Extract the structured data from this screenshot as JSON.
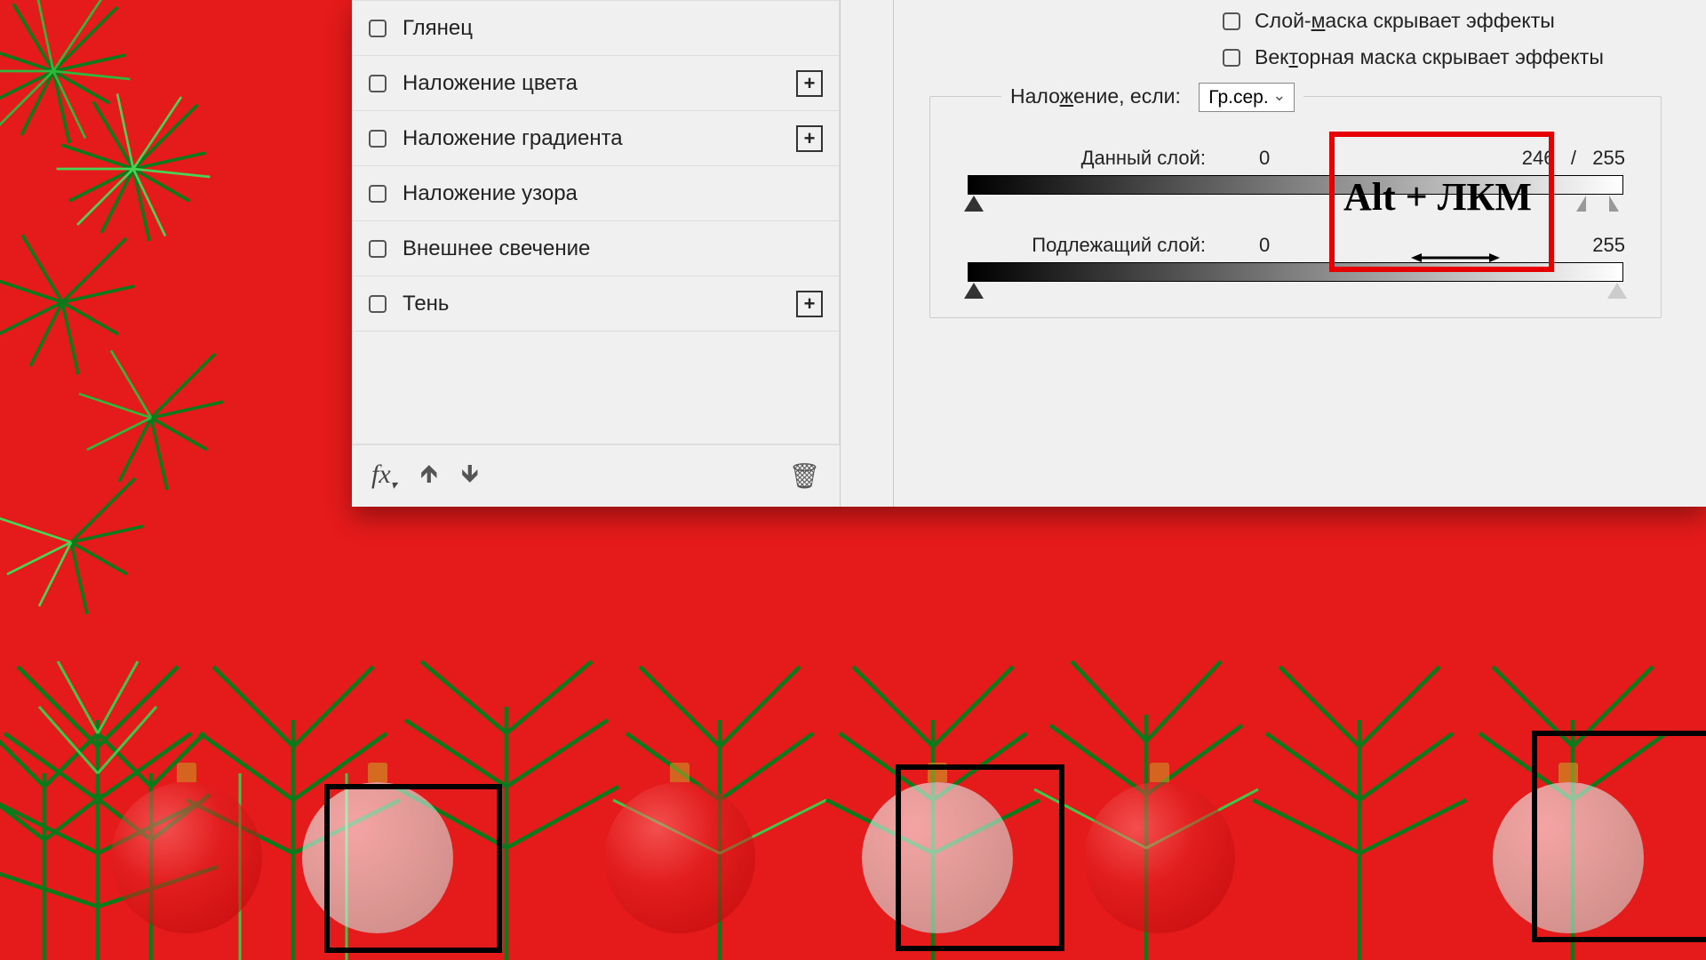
{
  "effects_list": {
    "items": [
      {
        "label": "Глянец",
        "has_plus": false
      },
      {
        "label": "Наложение цвета",
        "has_plus": true
      },
      {
        "label": "Наложение градиента",
        "has_plus": true
      },
      {
        "label": "Наложение узора",
        "has_plus": false
      },
      {
        "label": "Внешнее свечение",
        "has_plus": false
      },
      {
        "label": "Тень",
        "has_plus": true
      }
    ]
  },
  "footer": {
    "fx_label": "fx"
  },
  "right": {
    "chk_layer_mask": "Слой-маска скрывает эффекты",
    "chk_layer_mask_underline": "м",
    "chk_vector_mask": "Векторная маска скрывает эффекты",
    "chk_vector_mask_underline": "т"
  },
  "blend": {
    "legend": "Наложение, если:",
    "legend_underline": "ж",
    "dropdown_value": "Гр.сер.",
    "this_layer": {
      "label": "Данный слой:",
      "min": "0",
      "max_a": "246",
      "sep": "/",
      "max_b": "255"
    },
    "under_layer": {
      "label": "Подлежащий слой:",
      "min": "0",
      "max": "255"
    }
  },
  "annotation": {
    "text": "Alt + ЛКМ"
  }
}
